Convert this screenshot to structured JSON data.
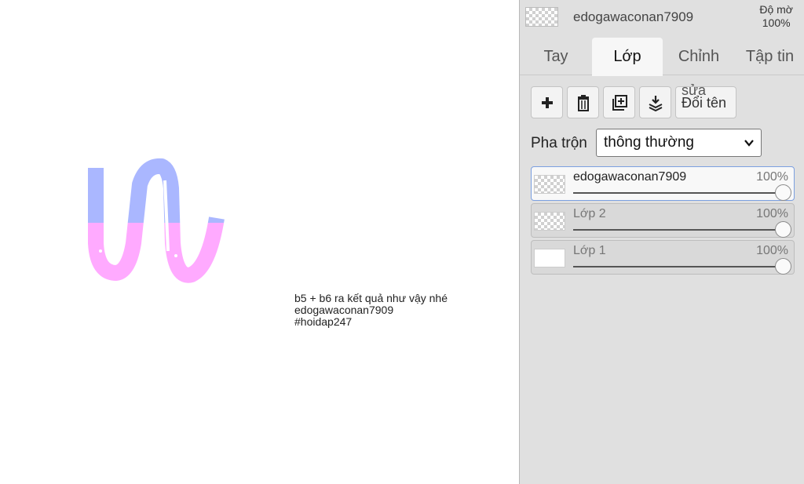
{
  "canvas": {
    "note_lines": [
      "b5 + b6 ra kết quả như vậy nhé",
      "edogawaconan7909",
      "#hoidap247"
    ]
  },
  "panel": {
    "top": {
      "name": "edogawaconan7909",
      "opacity_label_1": "Độ mờ",
      "opacity_label_2": "100%"
    },
    "tabs": [
      {
        "label": "Tay",
        "active": false
      },
      {
        "label": "Lớp",
        "active": true
      },
      {
        "label": "Chỉnh sửa",
        "active": false
      },
      {
        "label": "Tập tin",
        "active": false
      }
    ],
    "toolbar": {
      "add_icon": "plus-icon",
      "delete_icon": "trash-icon",
      "duplicate_icon": "duplicate-layer-icon",
      "merge_icon": "merge-down-icon",
      "rename_label": "Đổi tên",
      "edit_overlay": "sửa"
    },
    "blend": {
      "label": "Pha trộn",
      "value": "thông thường"
    },
    "layers": [
      {
        "name": "edogawaconan7909",
        "opacity_text": "100%",
        "opacity": 1.0,
        "selected": true,
        "thumb": "transparent"
      },
      {
        "name": "Lớp 2",
        "opacity_text": "100%",
        "opacity": 1.0,
        "selected": false,
        "thumb": "transparent"
      },
      {
        "name": "Lớp 1",
        "opacity_text": "100%",
        "opacity": 1.0,
        "selected": false,
        "thumb": "white"
      }
    ]
  },
  "colors": {
    "stroke_top": "#aab7ff",
    "stroke_bottom": "#ffaaff",
    "accent_border": "#7b9fe0"
  }
}
